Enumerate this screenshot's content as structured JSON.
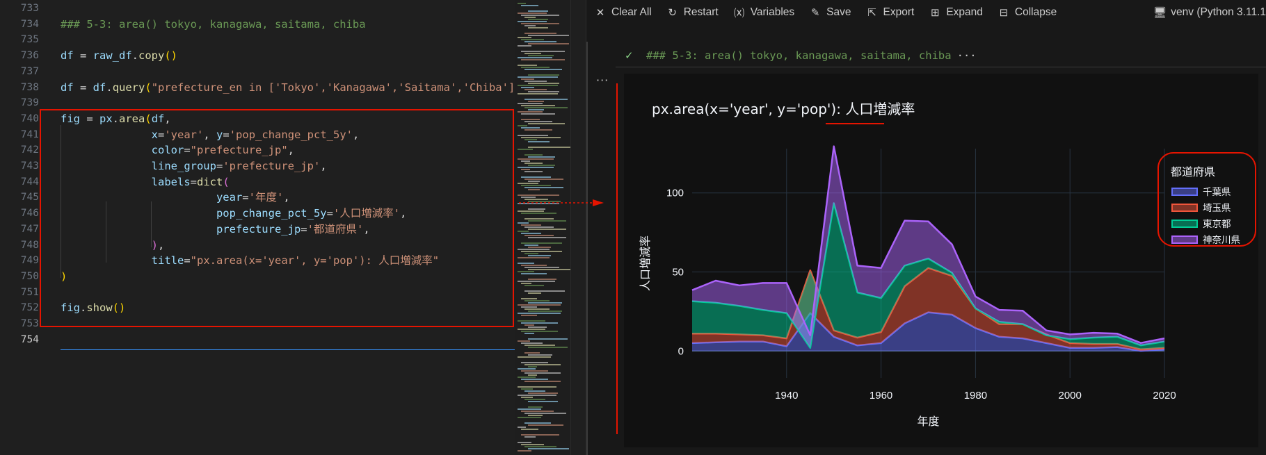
{
  "editor": {
    "lines": [
      {
        "n": "733",
        "tokens": []
      },
      {
        "n": "734",
        "tokens": [
          {
            "c": "cm",
            "t": "### 5-3: area() tokyo, kanagawa, saitama, chiba"
          }
        ]
      },
      {
        "n": "735",
        "tokens": []
      },
      {
        "n": "736",
        "tokens": [
          {
            "c": "vr",
            "t": "df"
          },
          {
            "c": "op",
            "t": " = "
          },
          {
            "c": "vr",
            "t": "raw_df"
          },
          {
            "c": "op",
            "t": "."
          },
          {
            "c": "fn",
            "t": "copy"
          },
          {
            "c": "b1",
            "t": "()"
          }
        ]
      },
      {
        "n": "737",
        "tokens": []
      },
      {
        "n": "738",
        "tokens": [
          {
            "c": "vr",
            "t": "df"
          },
          {
            "c": "op",
            "t": " = "
          },
          {
            "c": "vr",
            "t": "df"
          },
          {
            "c": "op",
            "t": "."
          },
          {
            "c": "fn",
            "t": "query"
          },
          {
            "c": "b1",
            "t": "("
          },
          {
            "c": "st",
            "t": "\"prefecture_en in ['Tokyo','Kanagawa','Saitama','Chiba']\""
          }
        ]
      },
      {
        "n": "739",
        "tokens": []
      },
      {
        "n": "740",
        "tokens": [
          {
            "c": "vr",
            "t": "fig"
          },
          {
            "c": "op",
            "t": " = "
          },
          {
            "c": "vr",
            "t": "px"
          },
          {
            "c": "op",
            "t": "."
          },
          {
            "c": "fn",
            "t": "area"
          },
          {
            "c": "b1",
            "t": "("
          },
          {
            "c": "vr",
            "t": "df"
          },
          {
            "c": "op",
            "t": ","
          }
        ]
      },
      {
        "n": "741",
        "tokens": [
          {
            "c": "op",
            "t": "              "
          },
          {
            "c": "vr",
            "t": "x"
          },
          {
            "c": "op",
            "t": "="
          },
          {
            "c": "st",
            "t": "'year'"
          },
          {
            "c": "op",
            "t": ", "
          },
          {
            "c": "vr",
            "t": "y"
          },
          {
            "c": "op",
            "t": "="
          },
          {
            "c": "st",
            "t": "'pop_change_pct_5y'"
          },
          {
            "c": "op",
            "t": ","
          }
        ]
      },
      {
        "n": "742",
        "tokens": [
          {
            "c": "op",
            "t": "              "
          },
          {
            "c": "vr",
            "t": "color"
          },
          {
            "c": "op",
            "t": "="
          },
          {
            "c": "st",
            "t": "\"prefecture_jp\""
          },
          {
            "c": "op",
            "t": ","
          }
        ]
      },
      {
        "n": "743",
        "tokens": [
          {
            "c": "op",
            "t": "              "
          },
          {
            "c": "vr",
            "t": "line_group"
          },
          {
            "c": "op",
            "t": "="
          },
          {
            "c": "st",
            "t": "'prefecture_jp'"
          },
          {
            "c": "op",
            "t": ","
          }
        ]
      },
      {
        "n": "744",
        "tokens": [
          {
            "c": "op",
            "t": "              "
          },
          {
            "c": "vr",
            "t": "labels"
          },
          {
            "c": "op",
            "t": "="
          },
          {
            "c": "fn",
            "t": "dict"
          },
          {
            "c": "b2",
            "t": "("
          }
        ]
      },
      {
        "n": "745",
        "tokens": [
          {
            "c": "op",
            "t": "                        "
          },
          {
            "c": "vr",
            "t": "year"
          },
          {
            "c": "op",
            "t": "="
          },
          {
            "c": "st",
            "t": "'年度'"
          },
          {
            "c": "op",
            "t": ","
          }
        ]
      },
      {
        "n": "746",
        "tokens": [
          {
            "c": "op",
            "t": "                        "
          },
          {
            "c": "vr",
            "t": "pop_change_pct_5y"
          },
          {
            "c": "op",
            "t": "="
          },
          {
            "c": "st",
            "t": "'人口増減率'"
          },
          {
            "c": "op",
            "t": ","
          }
        ]
      },
      {
        "n": "747",
        "tokens": [
          {
            "c": "op",
            "t": "                        "
          },
          {
            "c": "vr",
            "t": "prefecture_jp"
          },
          {
            "c": "op",
            "t": "="
          },
          {
            "c": "st",
            "t": "'都道府県'"
          },
          {
            "c": "op",
            "t": ","
          }
        ]
      },
      {
        "n": "748",
        "tokens": [
          {
            "c": "op",
            "t": "              "
          },
          {
            "c": "b2",
            "t": ")"
          },
          {
            "c": "op",
            "t": ","
          }
        ]
      },
      {
        "n": "749",
        "tokens": [
          {
            "c": "op",
            "t": "              "
          },
          {
            "c": "vr",
            "t": "title"
          },
          {
            "c": "op",
            "t": "="
          },
          {
            "c": "st",
            "t": "\"px.area(x='year', y='pop'): 人口増減率\""
          }
        ]
      },
      {
        "n": "750",
        "tokens": [
          {
            "c": "b1",
            "t": ")"
          }
        ]
      },
      {
        "n": "751",
        "tokens": []
      },
      {
        "n": "752",
        "tokens": [
          {
            "c": "vr",
            "t": "fig"
          },
          {
            "c": "op",
            "t": "."
          },
          {
            "c": "fn",
            "t": "show"
          },
          {
            "c": "b1",
            "t": "()"
          }
        ]
      },
      {
        "n": "753",
        "tokens": []
      },
      {
        "n": "754",
        "tokens": []
      }
    ],
    "active_line": "754"
  },
  "toolbar": {
    "buttons": [
      {
        "name": "clear-all-button",
        "icon": "close-icon",
        "glyph": "✕",
        "label": "Clear All"
      },
      {
        "name": "restart-button",
        "icon": "restart-icon",
        "glyph": "↻",
        "label": "Restart"
      },
      {
        "name": "variables-button",
        "icon": "variables-icon",
        "glyph": "⒳",
        "label": "Variables"
      },
      {
        "name": "save-button",
        "icon": "save-icon",
        "glyph": "✎",
        "label": "Save"
      },
      {
        "name": "export-button",
        "icon": "export-icon",
        "glyph": "⇱",
        "label": "Export"
      },
      {
        "name": "expand-button",
        "icon": "expand-icon",
        "glyph": "⊞",
        "label": "Expand"
      },
      {
        "name": "collapse-button",
        "icon": "collapse-icon",
        "glyph": "⊟",
        "label": "Collapse"
      }
    ],
    "kernel": "venv (Python 3.11.1"
  },
  "cell": {
    "title": "### 5-3: area() tokyo, kanagawa, saitama, chiba",
    "ellipsis": "···",
    "more": "···"
  },
  "chart_data": {
    "type": "area",
    "stacked": true,
    "title": "px.area(x='year', y='pop'): 人口増減率",
    "xlabel": "年度",
    "ylabel": "人口増減率",
    "xlim": [
      1920,
      2020
    ],
    "ylim": [
      -17,
      128
    ],
    "xticks": [
      1940,
      1960,
      1980,
      2000,
      2020
    ],
    "yticks": [
      0,
      50,
      100
    ],
    "grid": true,
    "legend": {
      "title": "都道府県",
      "position": "top-right"
    },
    "x": [
      1920,
      1925,
      1930,
      1935,
      1940,
      1945,
      1950,
      1955,
      1960,
      1965,
      1970,
      1975,
      1980,
      1985,
      1990,
      1995,
      2000,
      2005,
      2010,
      2015,
      2020
    ],
    "series": [
      {
        "name": "千葉県",
        "color": "#636efa",
        "values": [
          5,
          5.5,
          6,
          6,
          3,
          24,
          9,
          3.5,
          5,
          17.5,
          24.5,
          23,
          14.5,
          9,
          8,
          5,
          2,
          2,
          2.5,
          0.1,
          1
        ]
      },
      {
        "name": "埼玉県",
        "color": "#ef553b",
        "values": [
          6,
          5.5,
          4.5,
          4,
          5,
          27,
          4,
          5,
          7,
          23.5,
          28,
          24.5,
          12.5,
          8,
          9,
          5.5,
          3,
          2.5,
          2,
          1,
          1
        ]
      },
      {
        "name": "東京都",
        "color": "#00cc96",
        "values": [
          20.5,
          19.5,
          18,
          16,
          16,
          -49,
          80.5,
          28.5,
          21.5,
          13,
          6,
          2,
          0,
          1.5,
          0,
          -0.5,
          2.5,
          4,
          4.5,
          2.5,
          4
        ]
      },
      {
        "name": "神奈川県",
        "color": "#ab63fa",
        "values": [
          7,
          14,
          13,
          17,
          19,
          8,
          36,
          17,
          19,
          28.5,
          23.5,
          18,
          7.5,
          7.5,
          8.5,
          3,
          3,
          3,
          2,
          1.5,
          2
        ]
      }
    ]
  }
}
